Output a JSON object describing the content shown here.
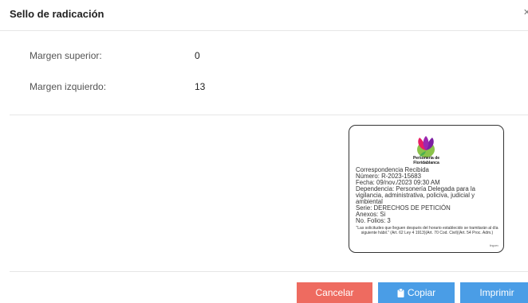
{
  "dialog": {
    "title": "Sello de radicación",
    "close_icon": "close-icon"
  },
  "form": {
    "top_margin": {
      "label": "Margen superior:",
      "value": "0"
    },
    "left_margin": {
      "label": "Margen izquierdo:",
      "value": "13"
    }
  },
  "stamp": {
    "logo_icon": "personeria-logo",
    "org_name_line1": "Personería de",
    "org_name_line2": "Floridablanca",
    "lines": {
      "heading": "Correspondencia Recibida",
      "number": "Número: R-2023-15683",
      "date": "Fecha: 09/nov./2023 09:30 AM",
      "dependency": "Dependencia: Personería Delegada para la vigilancia, administrativa, policiva, judicial y ambiental",
      "series": "Serie: DERECHOS DE PETICIÓN",
      "annexes": "Anexos: Si",
      "folios": "No. Folios: 3"
    },
    "note": "\"Las solicitudes que lleguen después del horario establecido se tramitarán al día siguiente hábil.\" (Art. 62 Ley 4 1913)(Art. 70 Cod. Civil)(Art. 54 Proc. Adm.)",
    "code": "lingoev"
  },
  "buttons": {
    "cancel": "Cancelar",
    "copy": "Copiar",
    "copy_icon": "clipboard-icon",
    "print": "Imprimir"
  },
  "colors": {
    "cancel": "#ee6b60",
    "primary": "#4a9de6"
  }
}
